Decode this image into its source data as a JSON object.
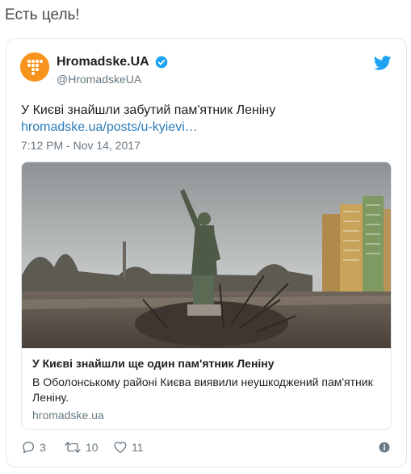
{
  "page": {
    "heading": "Есть цель!"
  },
  "tweet": {
    "author_name": "Hromadske.UA",
    "author_handle": "@HromadskeUA",
    "text": "У Києві знайшли забутий пам'ятник Леніну",
    "link": "hromadske.ua/posts/u-kyievi…",
    "timestamp": "7:12 PM - Nov 14, 2017",
    "card": {
      "title": "У Києві знайшли ще один пам'ятник Леніну",
      "description": "В Оболонському районі Києва виявили неушкоджений пам'ятник Леніну.",
      "domain": "hromadske.ua"
    },
    "actions": {
      "replies": "3",
      "retweets": "10",
      "likes": "11"
    }
  },
  "colors": {
    "avatar": "#f7941d",
    "link": "#2b7bb9",
    "twitter_blue": "#1da1f2",
    "muted": "#697882"
  },
  "icons": [
    "avatar-logo",
    "verified-icon",
    "twitter-bird-icon",
    "reply-icon",
    "retweet-icon",
    "like-icon",
    "info-icon"
  ]
}
